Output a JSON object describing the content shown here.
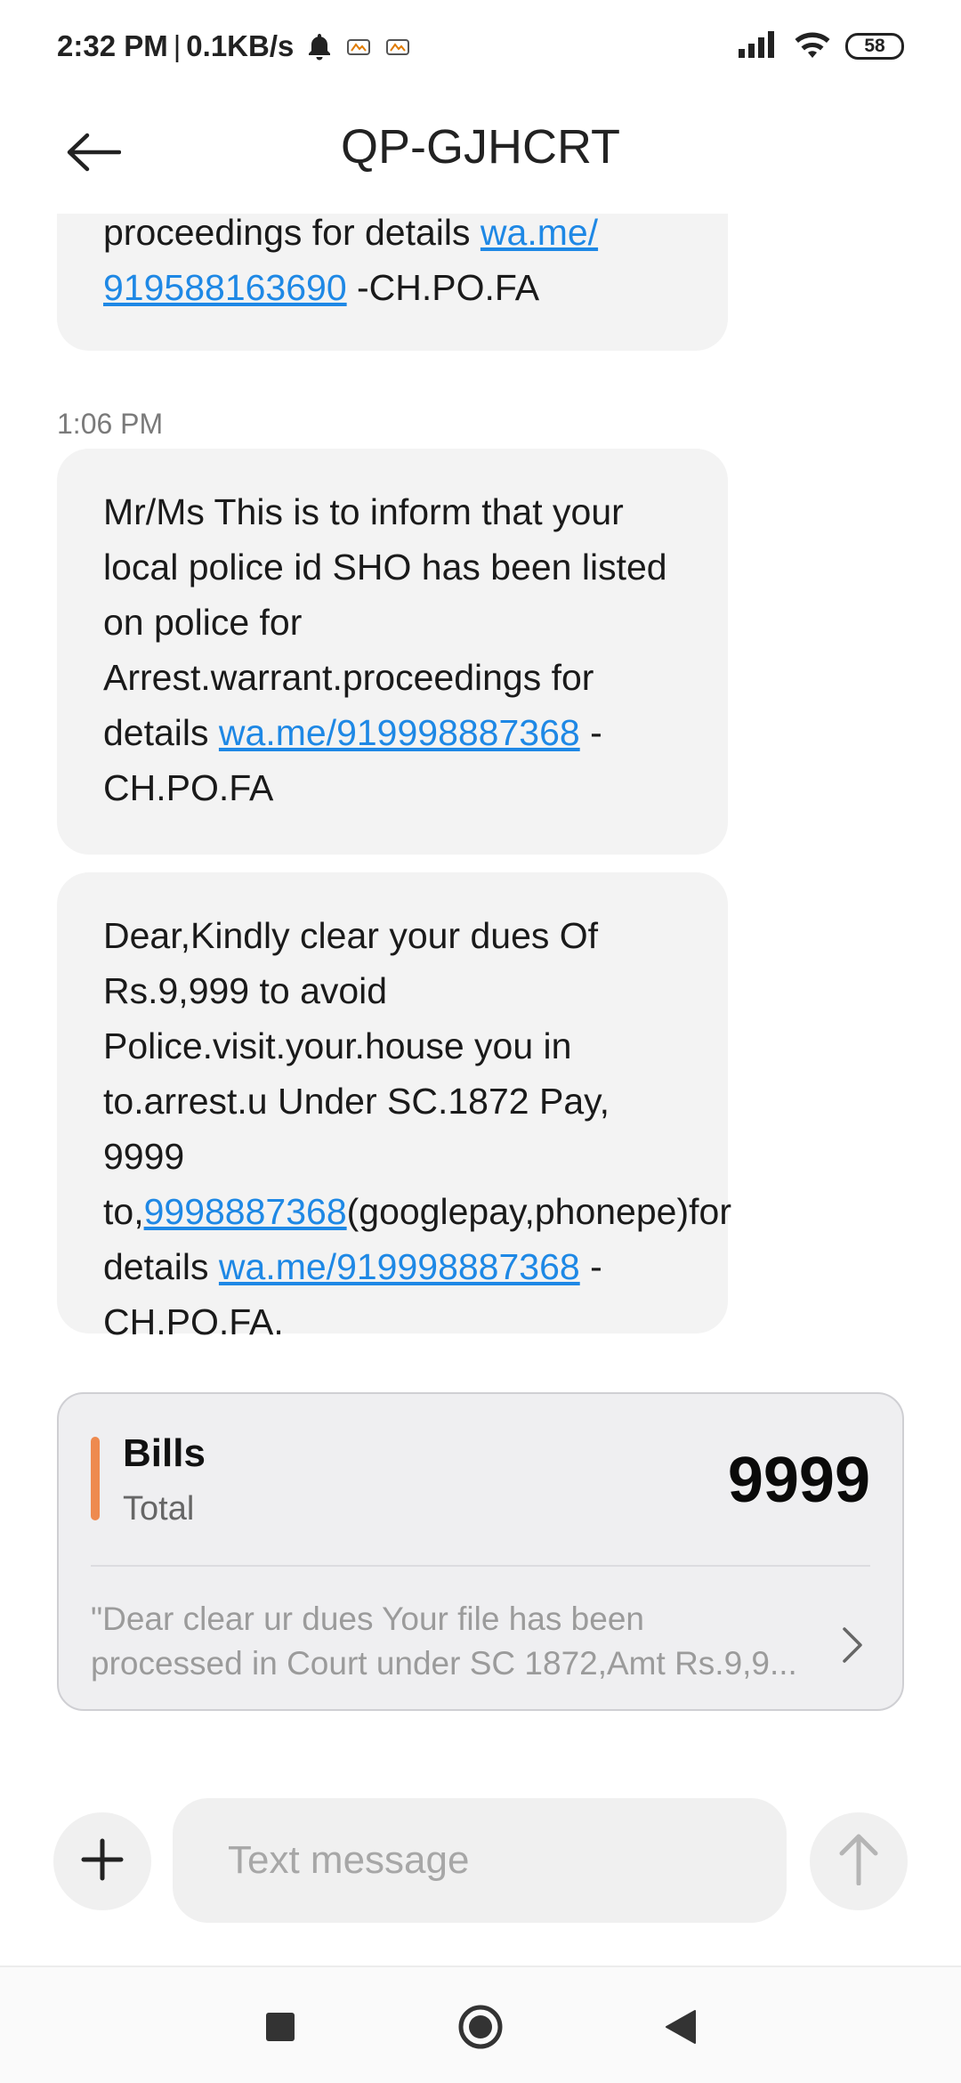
{
  "status_bar": {
    "time": "2:32 PM",
    "separator": "|",
    "speed": "0.1KB/s",
    "battery": "58"
  },
  "header": {
    "title": "QP-GJHCRT"
  },
  "messages": [
    {
      "line1_text": "proceedings for details ",
      "line1_link": "wa.me/",
      "line2_link": "919588163690",
      "line2_text": " -CH.PO.FA"
    },
    {
      "timestamp": "1:06 PM",
      "text_before": "Mr/Ms This is to inform that your local police id SHO has been listed on police for Arrest.warrant.proceedings for details ",
      "link": "wa.me/919998887368",
      "text_after": " -CH.PO.FA"
    },
    {
      "text_before": "Dear,Kindly clear your dues Of Rs.9,999 to avoid Police.visit.your.house you in to.arrest.u Under SC.1872 Pay, 9999 to,",
      "link_phone": "9998887368",
      "text_mid": "(googlepay,phonepe)for details ",
      "link_wa": "wa.me/919998887368",
      "text_after": " -CH.PO.FA."
    }
  ],
  "bills_card": {
    "title": "Bills",
    "subtitle": "Total",
    "amount": "9999",
    "preview_line1": "\"Dear clear ur dues Your file has been",
    "preview_line2": "processed in Court under SC 1872,Amt Rs.9,9...",
    "accent_color": "#ee8a4f"
  },
  "composer": {
    "placeholder": "Text message",
    "value": ""
  },
  "icons": {
    "back": "arrow-left-icon",
    "add": "plus-icon",
    "send": "arrow-up-icon",
    "chevron": "chevron-right-icon"
  }
}
